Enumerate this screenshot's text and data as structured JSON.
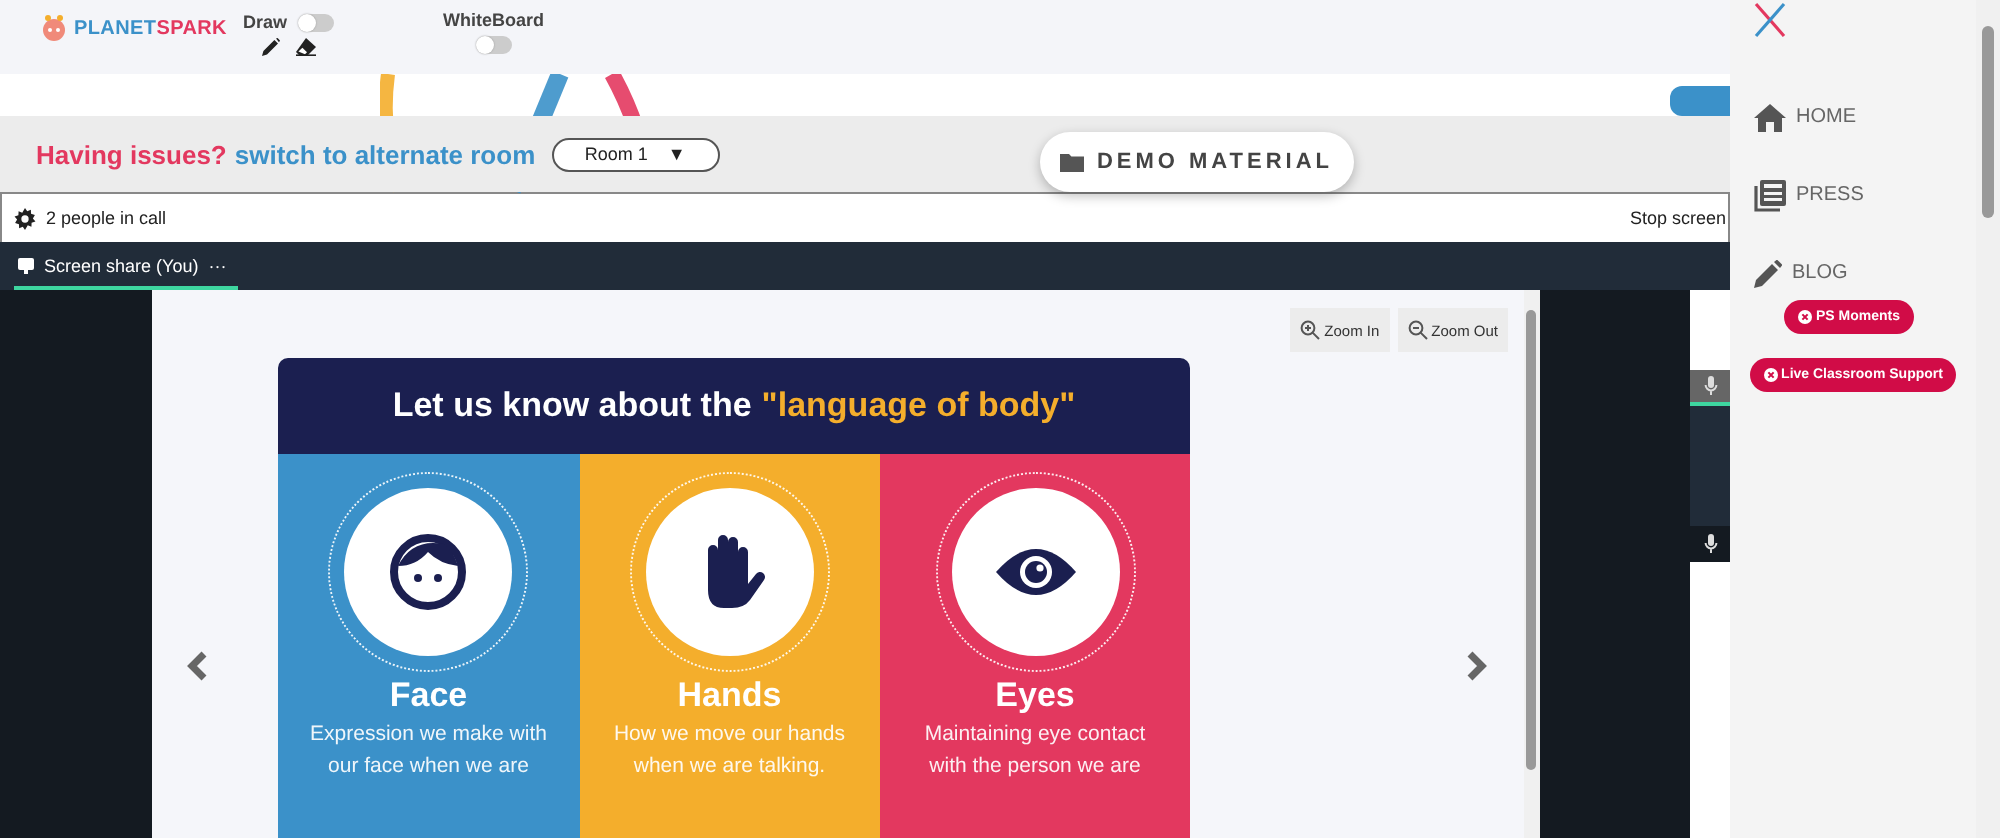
{
  "header": {
    "logo": {
      "first": "PLANET",
      "second": "SPARK"
    },
    "draw": {
      "label": "Draw",
      "on": false
    },
    "whiteboard": {
      "label": "WhiteBoard",
      "on": false
    }
  },
  "issues": {
    "question": "Having issues?",
    "link": "switch to alternate room",
    "room": "Room 1",
    "caret": "▼"
  },
  "demo_button": "DEMO MATERIAL",
  "call": {
    "people": "2 people in call",
    "stop": "Stop screen"
  },
  "tab": {
    "label": "Screen share (You)",
    "selected": true,
    "more": "···"
  },
  "viewer": {
    "zoom_in": "Zoom In",
    "zoom_out": "Zoom Out"
  },
  "slide": {
    "title": "Let us know about the",
    "highlight": "\"language of body\"",
    "columns": [
      {
        "kind": "face",
        "heading": "Face",
        "color": "#3b91c9",
        "lines": [
          "Expression we make with",
          "our face when we are"
        ]
      },
      {
        "kind": "hands",
        "heading": "Hands",
        "color": "#f4ae2c",
        "lines": [
          "How we move our hands",
          "when we are talking."
        ]
      },
      {
        "kind": "eyes",
        "heading": "Eyes",
        "color": "#e3385f",
        "lines": [
          "Maintaining eye contact",
          "with the person we are"
        ]
      }
    ]
  },
  "sidebar": {
    "items": [
      {
        "kind": "home",
        "label": "HOME"
      },
      {
        "kind": "press",
        "label": "PRESS"
      },
      {
        "kind": "blog",
        "label": "BLOG"
      }
    ],
    "pills": [
      "PS Moments",
      "Live Classroom Support"
    ]
  }
}
